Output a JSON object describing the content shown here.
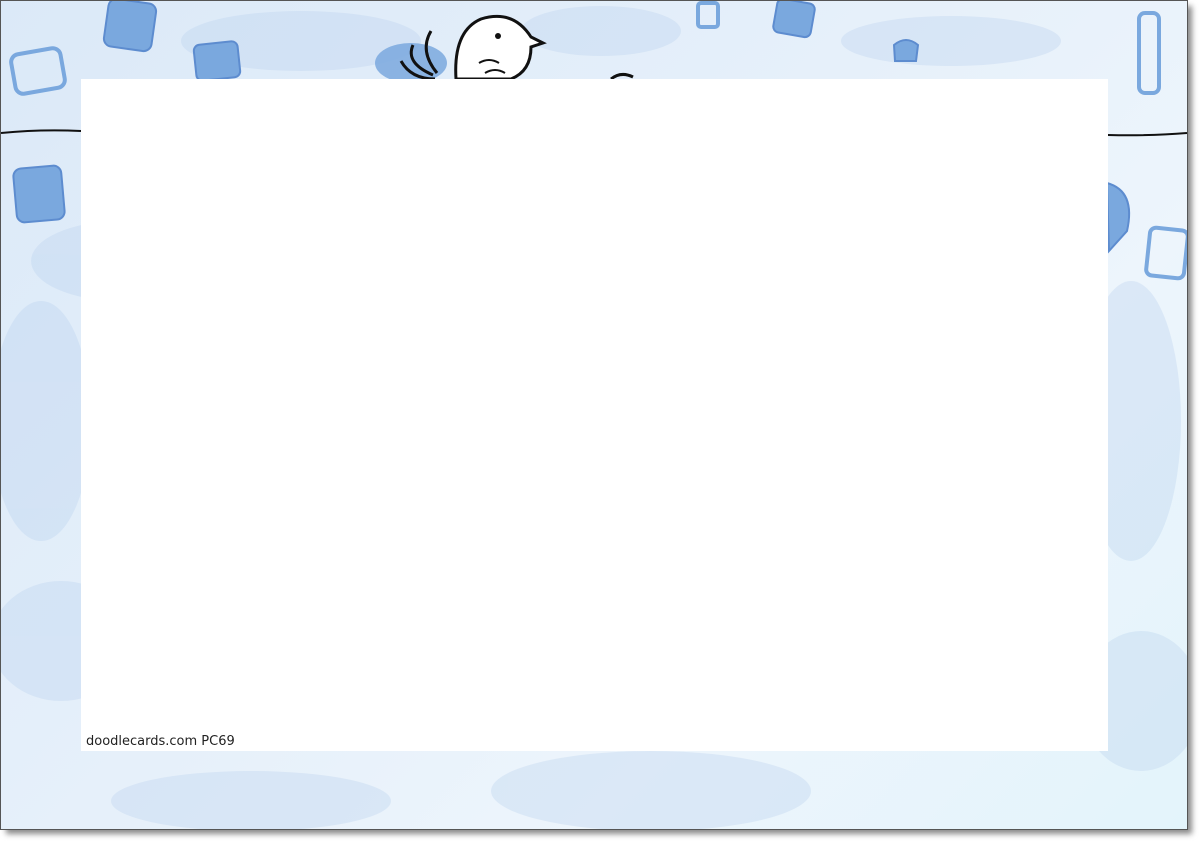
{
  "card": {
    "footer_text": "doodlecards.com PC69"
  },
  "colors": {
    "background_blue": "#dbe9f8",
    "doodle_blue": "#6f9fd8",
    "line_black": "#111111",
    "panel": "#ffffff"
  },
  "decorations": {
    "icons": [
      "bird-icon",
      "doodle-square-icon",
      "string-line"
    ]
  }
}
